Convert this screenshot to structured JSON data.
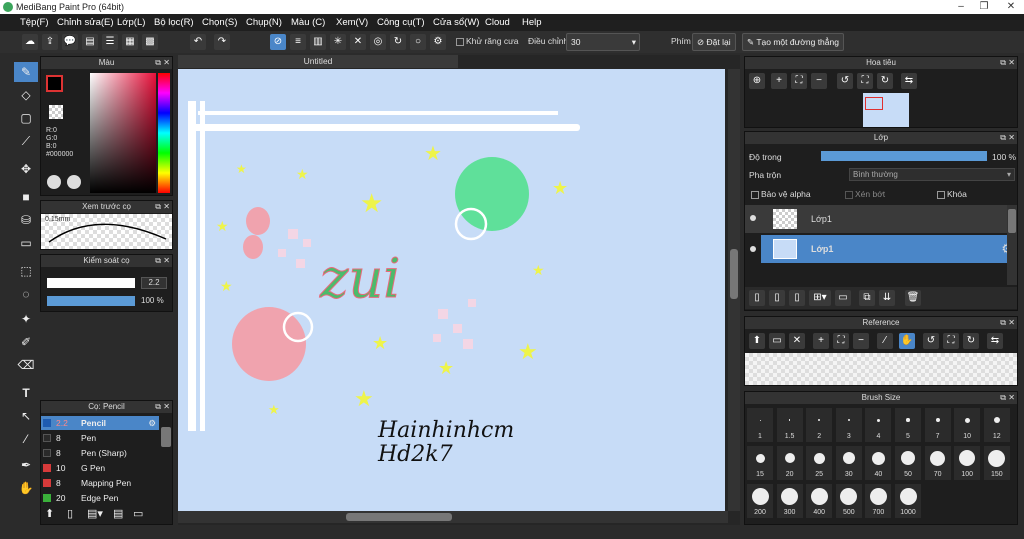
{
  "window": {
    "title": "MediBang Paint Pro (64bit)"
  },
  "menu": [
    "Tệp(F)",
    "Chỉnh sửa(E)",
    "Lớp(L)",
    "Bộ lọc(R)",
    "Chọn(S)",
    "Chụp(N)",
    "Màu (C)",
    "Xem(V)",
    "Công cụ(T)",
    "Cửa sổ(W)",
    "Cloud",
    "Help"
  ],
  "toolbar": {
    "antialias": "Khử răng cưa",
    "adjust_label": "Điều chỉnh",
    "adjust_value": "30",
    "shortcut_label": "Phím",
    "reset_label": "Đặt lại",
    "line_label": "Tạo một đường thẳng"
  },
  "document": {
    "tab": "Untitled"
  },
  "color_panel": {
    "title": "Màu",
    "r": "R:0",
    "g": "G:0",
    "b": "B:0",
    "hex": "#000000",
    "fg": "#000000"
  },
  "brush_preview": {
    "title": "Xem trước cọ",
    "size": "0.15mm"
  },
  "brush_control": {
    "title": "Kiểm soát cọ",
    "size": "2.2",
    "opacity": "100 %"
  },
  "brush_list": {
    "title": "Cọ: Pencil",
    "items": [
      {
        "size": "2.2",
        "name": "Pencil",
        "color": "#1e5bb0"
      },
      {
        "size": "8",
        "name": "Pen",
        "color": "#2a2a2a"
      },
      {
        "size": "8",
        "name": "Pen (Sharp)",
        "color": "#2a2a2a"
      },
      {
        "size": "10",
        "name": "G Pen",
        "color": "#d63a3a"
      },
      {
        "size": "8",
        "name": "Mapping Pen",
        "color": "#d63a3a"
      },
      {
        "size": "20",
        "name": "Edge Pen",
        "color": "#3ab03a"
      }
    ]
  },
  "navigator": {
    "title": "Hoa tiêu"
  },
  "layer_panel": {
    "title": "Lớp",
    "opacity_label": "Độ trong",
    "opacity_value": "100 %",
    "opacity_fraction": 1.0,
    "blend_label": "Pha trộn",
    "blend_value": "Bình thường",
    "protect_alpha": "Bảo vệ alpha",
    "clip": "Xén bớt",
    "lock": "Khóa",
    "layers": [
      {
        "name": "Lớp1"
      },
      {
        "name": "Lớp1"
      }
    ]
  },
  "reference": {
    "title": "Reference"
  },
  "brush_size": {
    "title": "Brush Size",
    "sizes": [
      "1",
      "1.5",
      "2",
      "3",
      "4",
      "5",
      "7",
      "10",
      "12",
      "15",
      "20",
      "25",
      "30",
      "40",
      "50",
      "70",
      "100",
      "150",
      "200",
      "300",
      "400",
      "500",
      "700",
      "1000"
    ]
  },
  "artwork": {
    "word": "zui",
    "signature_line1": "Hainhinhcm",
    "signature_line2": "Hd2k7"
  }
}
